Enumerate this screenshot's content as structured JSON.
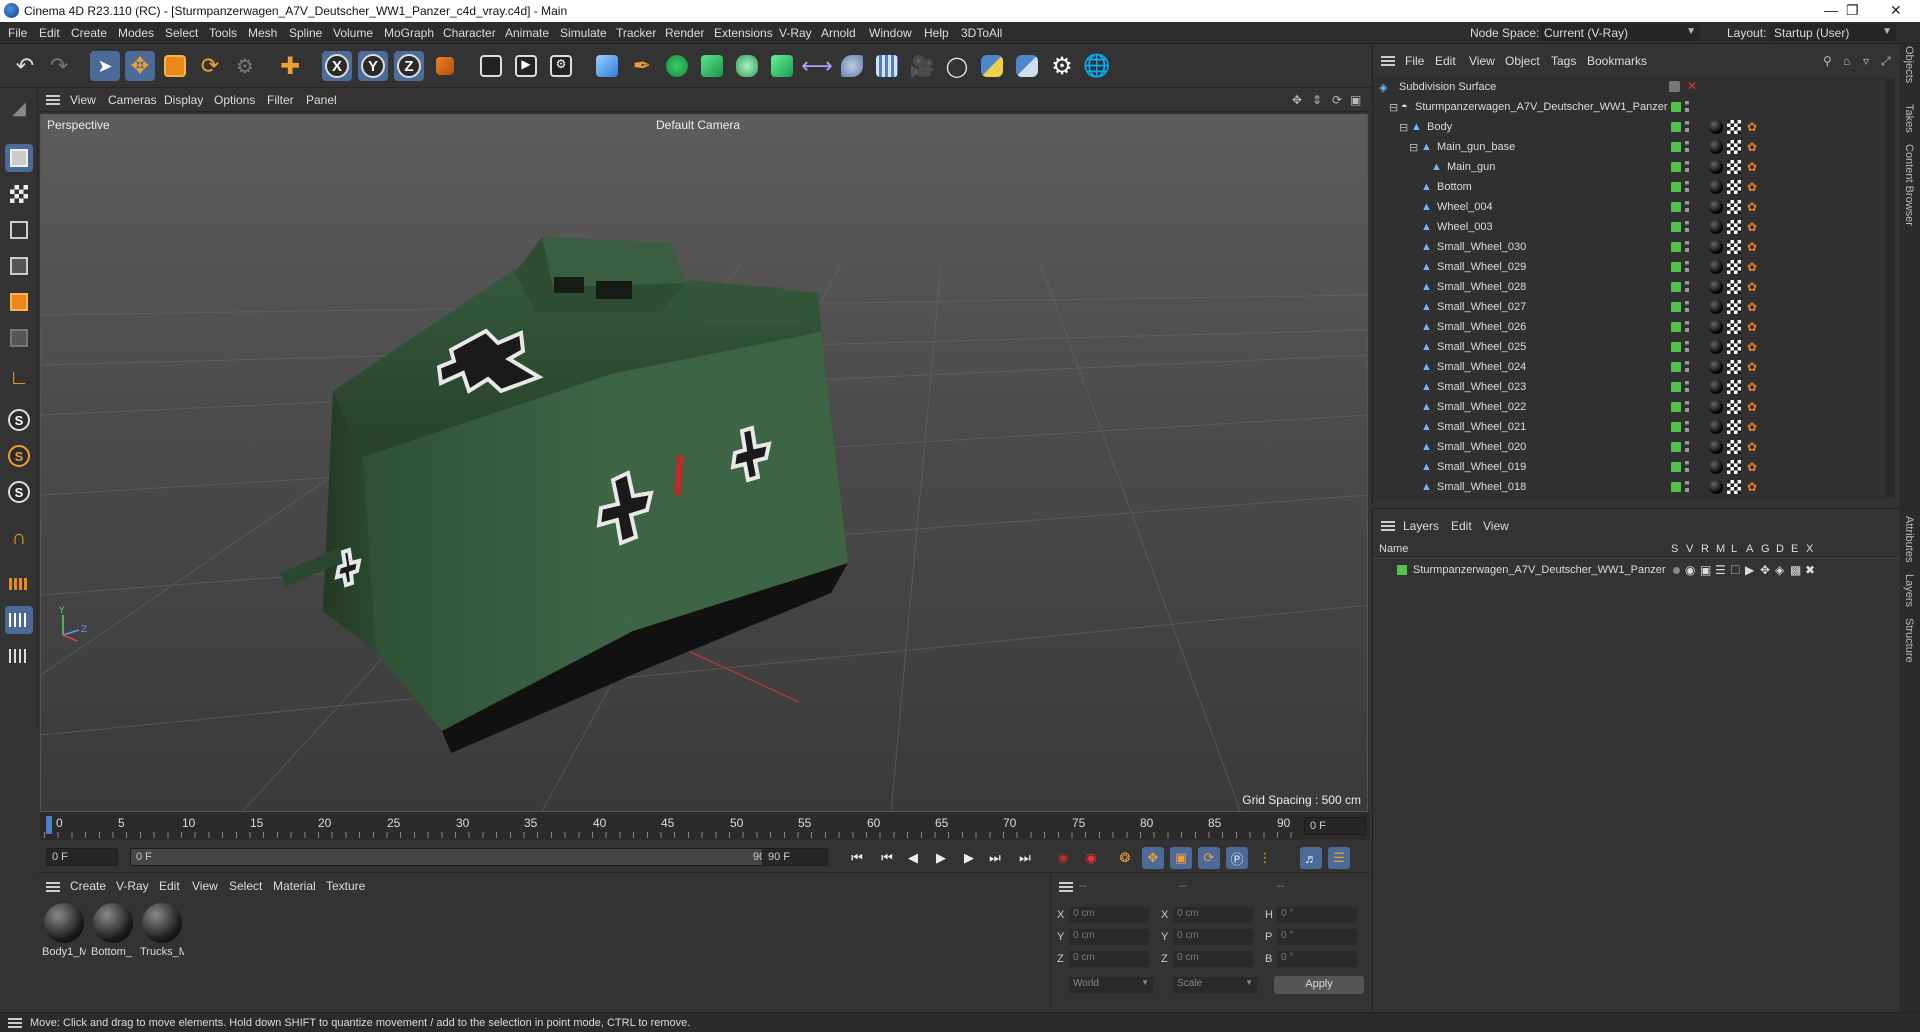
{
  "window": {
    "title": "Cinema 4D R23.110 (RC) - [Sturmpanzerwagen_A7V_Deutscher_WW1_Panzer_c4d_vray.c4d] - Main"
  },
  "menubar": {
    "items": [
      "File",
      "Edit",
      "Create",
      "Modes",
      "Select",
      "Tools",
      "Mesh",
      "Spline",
      "Volume",
      "MoGraph",
      "Character",
      "Animate",
      "Simulate",
      "Tracker",
      "Render",
      "Extensions",
      "V-Ray",
      "Arnold",
      "Window",
      "Help",
      "3DToAll"
    ],
    "node_space_label": "Node Space:",
    "node_space_value": "Current (V-Ray)",
    "layout_label": "Layout:",
    "layout_value": "Startup (User)"
  },
  "viewport": {
    "menu": [
      "View",
      "Cameras",
      "Display",
      "Options",
      "Filter",
      "Panel"
    ],
    "projection": "Perspective",
    "camera": "Default Camera",
    "grid_spacing": "Grid Spacing : 500 cm"
  },
  "timeline": {
    "ticks": [
      "0",
      "5",
      "10",
      "15",
      "20",
      "25",
      "30",
      "35",
      "40",
      "45",
      "50",
      "55",
      "60",
      "65",
      "70",
      "75",
      "80",
      "85",
      "90"
    ],
    "current_frame": "0 F",
    "start_frame": "0 F",
    "min_frame": "0 F",
    "max_frame": "90 F",
    "end_frame": "90 F"
  },
  "materials": {
    "menu": [
      "Create",
      "V-Ray",
      "Edit",
      "View",
      "Select",
      "Material",
      "Texture"
    ],
    "items": [
      {
        "label": "Body1_M"
      },
      {
        "label": "Bottom_"
      },
      {
        "label": "Trucks_M"
      }
    ]
  },
  "coords": {
    "headers": [
      "--",
      "--",
      "--"
    ],
    "rows": [
      {
        "a": "X",
        "av": "0 cm",
        "b": "X",
        "bv": "0 cm",
        "c": "H",
        "cv": "0 °"
      },
      {
        "a": "Y",
        "av": "0 cm",
        "b": "Y",
        "bv": "0 cm",
        "c": "P",
        "cv": "0 °"
      },
      {
        "a": "Z",
        "av": "0 cm",
        "b": "Z",
        "bv": "0 cm",
        "c": "B",
        "cv": "0 °"
      }
    ],
    "space": "World",
    "mode": "Scale",
    "apply": "Apply"
  },
  "objects": {
    "menu": [
      "File",
      "Edit",
      "View",
      "Object",
      "Tags",
      "Bookmarks"
    ],
    "items": [
      {
        "name": "Subdivision Surface",
        "level": 0
      },
      {
        "name": "Sturmpanzerwagen_A7V_Deutscher_WW1_Panzer",
        "level": 1
      },
      {
        "name": "Body",
        "level": 2
      },
      {
        "name": "Main_gun_base",
        "level": 3
      },
      {
        "name": "Main_gun",
        "level": 4
      },
      {
        "name": "Bottom",
        "level": 3
      },
      {
        "name": "Wheel_004",
        "level": 3
      },
      {
        "name": "Wheel_003",
        "level": 3
      },
      {
        "name": "Small_Wheel_030",
        "level": 3
      },
      {
        "name": "Small_Wheel_029",
        "level": 3
      },
      {
        "name": "Small_Wheel_028",
        "level": 3
      },
      {
        "name": "Small_Wheel_027",
        "level": 3
      },
      {
        "name": "Small_Wheel_026",
        "level": 3
      },
      {
        "name": "Small_Wheel_025",
        "level": 3
      },
      {
        "name": "Small_Wheel_024",
        "level": 3
      },
      {
        "name": "Small_Wheel_023",
        "level": 3
      },
      {
        "name": "Small_Wheel_022",
        "level": 3
      },
      {
        "name": "Small_Wheel_021",
        "level": 3
      },
      {
        "name": "Small_Wheel_020",
        "level": 3
      },
      {
        "name": "Small_Wheel_019",
        "level": 3
      },
      {
        "name": "Small_Wheel_018",
        "level": 3
      }
    ]
  },
  "layers": {
    "menu": [
      "Layers",
      "Edit",
      "View"
    ],
    "col_name": "Name",
    "cols": [
      "S",
      "V",
      "R",
      "M",
      "L",
      "A",
      "G",
      "D",
      "E",
      "X"
    ],
    "items": [
      {
        "name": "Sturmpanzerwagen_A7V_Deutscher_WW1_Panzer",
        "color": "#54c34a"
      }
    ]
  },
  "side_tabs": [
    "Objects",
    "Takes",
    "Content Browser",
    "Attributes",
    "Layers",
    "Structure"
  ],
  "status": {
    "text": "Move: Click and drag to move elements. Hold down SHIFT to quantize movement / add to the selection in point mode, CTRL to remove."
  }
}
